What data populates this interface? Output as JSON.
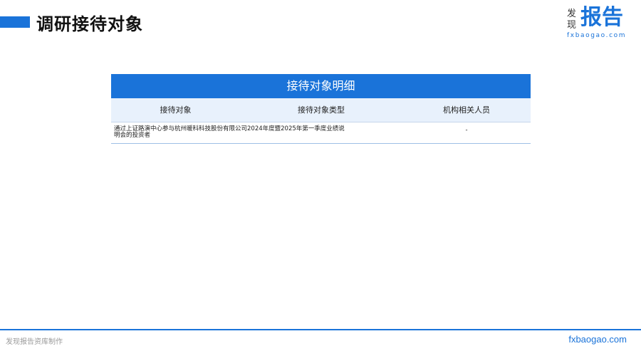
{
  "header": {
    "title": "调研接待对象"
  },
  "logo": {
    "small_text": "发现",
    "big_text": "报告",
    "domain": "fxbaogao.com"
  },
  "table": {
    "caption": "接待对象明细",
    "columns": [
      "接待对象",
      "接待对象类型",
      "机构相关人员"
    ],
    "rows": [
      {
        "object": "通过上证路演中心参与杭州暖科科技股份有限公司2024年度暨2025年第一季度业绩说明会的投资者",
        "type": "",
        "personnel": "-"
      }
    ]
  },
  "footer": {
    "left": "发现报告资库制作",
    "right": "fxbaogao.com"
  },
  "colors": {
    "accent": "#1a73d9",
    "header_row_bg": "#e8f1fc"
  }
}
